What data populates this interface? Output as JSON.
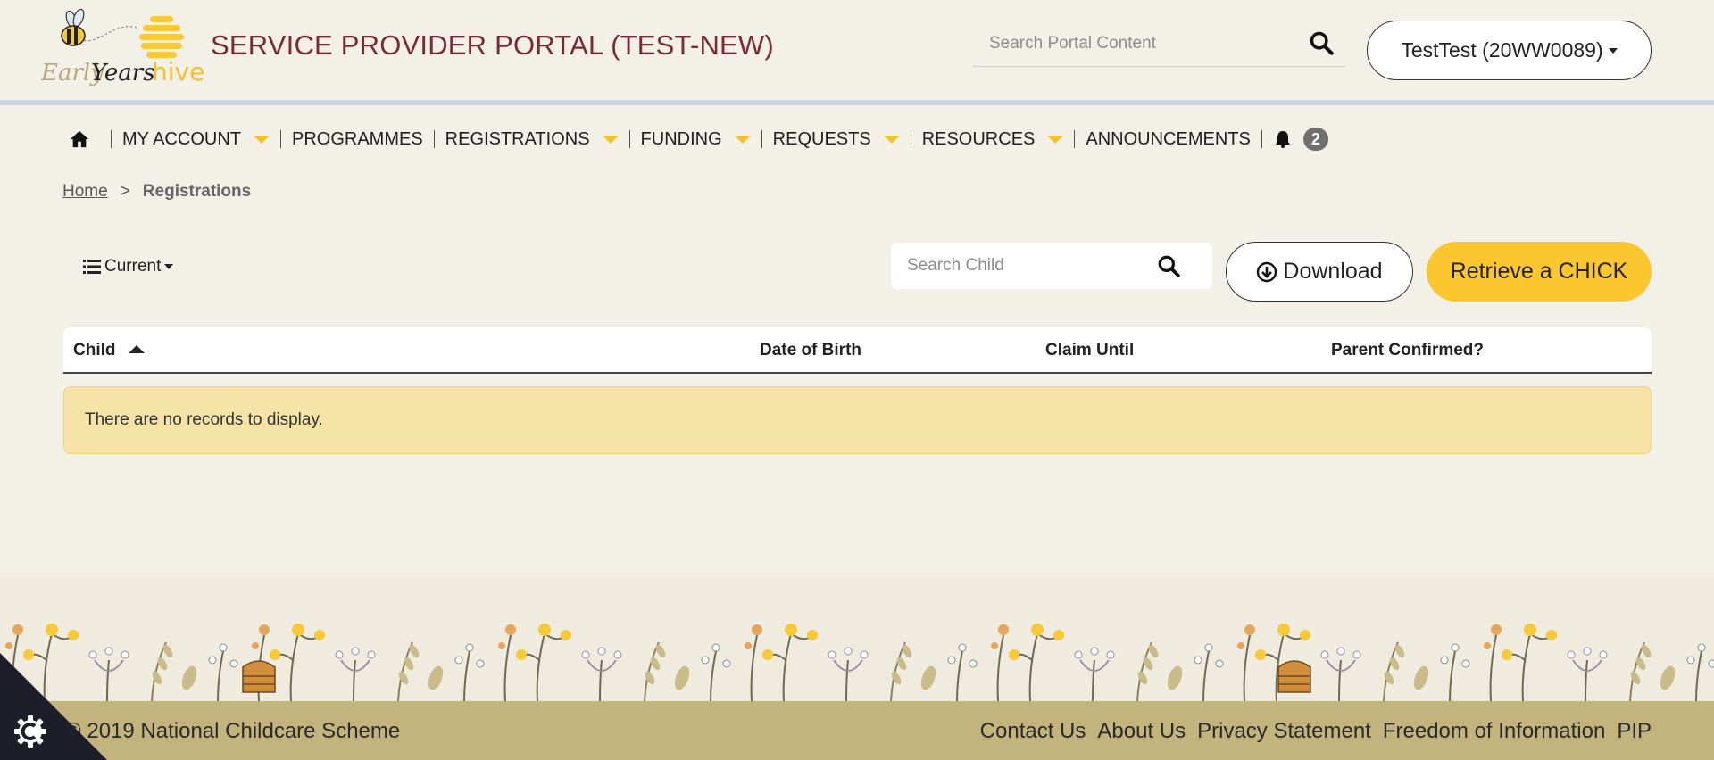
{
  "header": {
    "logo_text_early": "Early",
    "logo_text_years": "Years",
    "logo_text_hive": "hive",
    "title": "SERVICE PROVIDER PORTAL (TEST-NEW)",
    "search_placeholder": "Search Portal Content",
    "user_label": "TestTest (20WW0089)"
  },
  "nav": {
    "items": [
      {
        "label": "MY ACCOUNT",
        "dropdown": true
      },
      {
        "label": "PROGRAMMES",
        "dropdown": false
      },
      {
        "label": "REGISTRATIONS",
        "dropdown": true
      },
      {
        "label": "FUNDING",
        "dropdown": true
      },
      {
        "label": "REQUESTS",
        "dropdown": true
      },
      {
        "label": "RESOURCES",
        "dropdown": true
      },
      {
        "label": "ANNOUNCEMENTS",
        "dropdown": false
      }
    ],
    "notification_count": "2"
  },
  "breadcrumb": {
    "home": "Home",
    "separator": ">",
    "current": "Registrations"
  },
  "toolbar": {
    "filter_label": "Current",
    "search_placeholder": "Search Child",
    "download_label": "Download",
    "retrieve_label": "Retrieve a CHICK"
  },
  "table": {
    "columns": [
      "Child",
      "Date of Birth",
      "Claim Until",
      "Parent Confirmed?"
    ],
    "sort_column": "Child",
    "sort_direction": "ascending",
    "empty_message": "There are no records to display."
  },
  "footer": {
    "copyright": "© 2019 National Childcare Scheme",
    "links": [
      "Contact Us",
      "About Us",
      "Privacy Statement",
      "Freedom of Information",
      "PIP"
    ]
  },
  "colors": {
    "background": "#f3f0e8",
    "title": "#7a2a33",
    "accent_yellow": "#fbc62e",
    "nav_triangle": "#f2c12e",
    "empty_notice": "#f6e3a8",
    "footer": "#c2b47c",
    "header_rule": "#cbd6df"
  },
  "icons": {
    "home": "home-icon",
    "search": "search-icon",
    "bell": "bell-icon",
    "list": "list-icon",
    "download": "download-circle-icon",
    "cookie": "cookie-settings-icon"
  }
}
